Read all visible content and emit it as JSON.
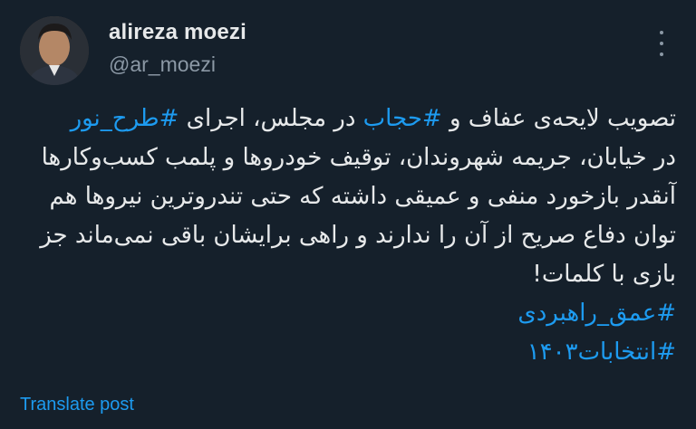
{
  "user": {
    "display_name": "alireza moezi",
    "handle": "@ar_moezi"
  },
  "tweet": {
    "line1": {
      "before": "تصویب لایحه‌ی عفاف و ",
      "tag1": "#حجاب",
      "middle": " در مجلس، اجرای ",
      "tag2": "#طرح_نور"
    },
    "line2": "در خیابان، جریمه شهروندان، توقیف خودروها و پلمب کسب‌وکارها",
    "line3": "آنقدر بازخورد منفی و عمیقی داشته که حتی تندروترین نیروها هم",
    "line4": "توان دفاع صریح از آن را ندارند و راهی برایشان باقی نمی‌ماند جز",
    "line5": "بازی با کلمات!",
    "hashtag_line1": "#عمق_راهبردی",
    "hashtag_line2": "#انتخابات۱۴۰۳"
  },
  "actions": {
    "translate_label": "Translate post",
    "more_icon": "more-vertical-icon"
  },
  "colors": {
    "background": "#15202b",
    "text": "#e7e9ea",
    "secondary": "#8b98a5",
    "accent": "#1d9bf0"
  }
}
